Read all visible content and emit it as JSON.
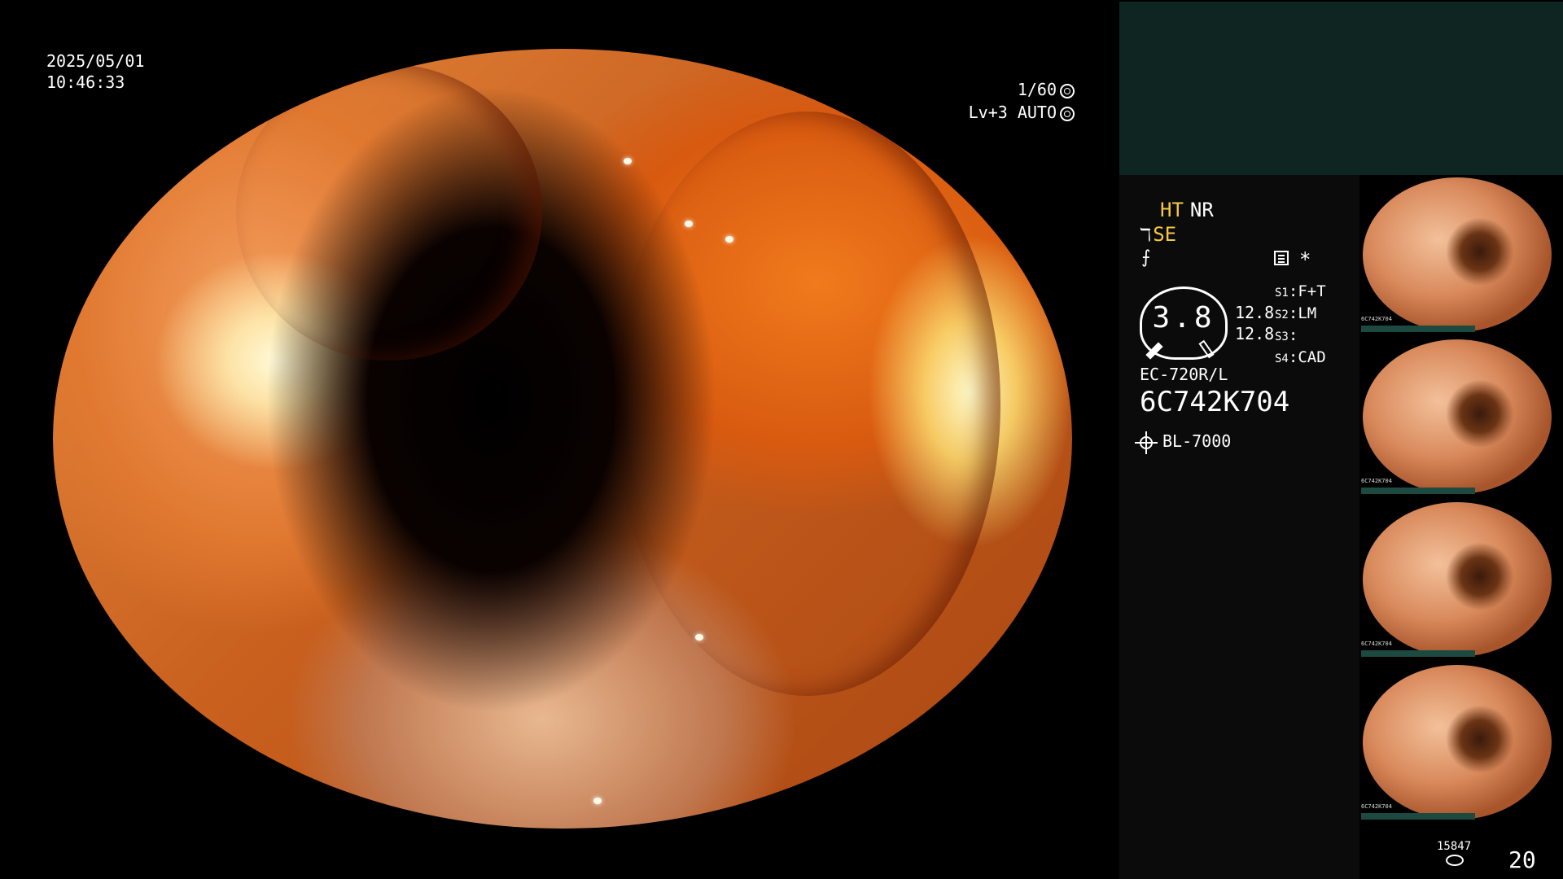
{
  "datetime": {
    "date": "2025/05/01",
    "time": "10:46:33"
  },
  "exposure": {
    "shutter": "1/60",
    "level": "Lv+3 AUTO",
    "shutter_icon": "aperture-icon",
    "auto_icon": "target-icon"
  },
  "modes": {
    "ht": "HT",
    "nr": "NR",
    "se": "SE",
    "se_icon": "scope-tip-icon",
    "f_icon": "f-curve-icon",
    "star": "*"
  },
  "gauge": {
    "value": "3.8",
    "val1": "12.8",
    "val2": "12.8"
  },
  "switches": [
    {
      "key": "S1",
      "value": "F+T"
    },
    {
      "key": "S2",
      "value": "LM"
    },
    {
      "key": "S3",
      "value": ""
    },
    {
      "key": "S4",
      "value": "CAD"
    }
  ],
  "scope": {
    "model": "EC-720R/L",
    "serial": "6C742K704"
  },
  "light_source": "BL-7000",
  "counters": {
    "image_count": "15847",
    "frame": "20"
  },
  "colors": {
    "accent": "#f5c842",
    "panel_teal": "#0f2522",
    "thumb_bar": "#1d4a40"
  },
  "thumbnails": [
    {
      "label": "6C742K704"
    },
    {
      "label": "6C742K704"
    },
    {
      "label": "6C742K704"
    },
    {
      "label": "6C742K704"
    }
  ]
}
